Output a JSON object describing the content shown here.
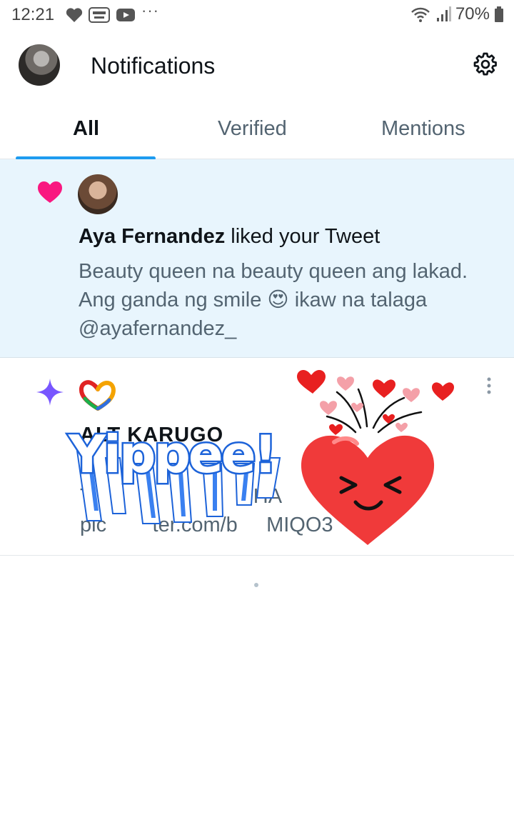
{
  "status_bar": {
    "time": "12:21",
    "more": "···",
    "battery": "70%"
  },
  "header": {
    "title": "Notifications"
  },
  "tabs": [
    {
      "label": "All",
      "active": true
    },
    {
      "label": "Verified",
      "active": false
    },
    {
      "label": "Mentions",
      "active": false
    }
  ],
  "notifications": [
    {
      "icon": "heart-icon",
      "user_name": "Aya Fernandez",
      "action": " liked your Tweet",
      "tweet_text": "Beauty queen na beauty queen ang lakad. Ang ganda ng smile 😍 ikaw na talaga @ayafernandez_"
    },
    {
      "icon": "sparkle-icon",
      "name_partial": "ALT KARUGO",
      "text_line1": "A                              A            A",
      "text_line2": "T                            HA            W.",
      "text_line3": "pic        ter.com/b     MIQO3"
    }
  ],
  "sticker": {
    "text": "Yippee!"
  },
  "colors": {
    "accent": "#1d9bf0",
    "like": "#f91880",
    "highlight_bg": "#e8f5fd"
  }
}
